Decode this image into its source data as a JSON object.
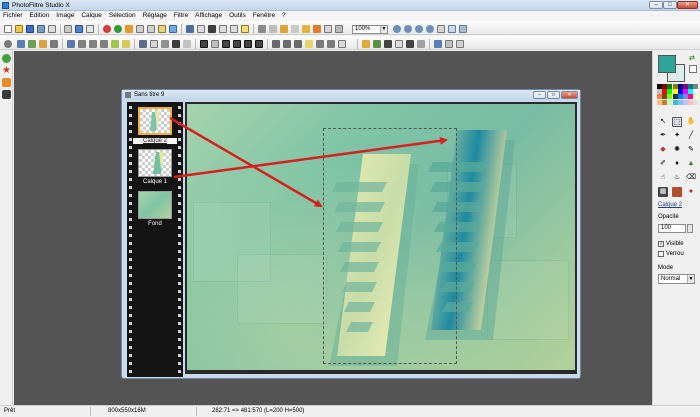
{
  "window": {
    "title": "PhotoFiltre Studio X",
    "min": "–",
    "max": "□",
    "close": "✕"
  },
  "menu": [
    "Fichier",
    "Edition",
    "Image",
    "Calque",
    "Sélection",
    "Réglage",
    "Filtre",
    "Affichage",
    "Outils",
    "Fenêtre",
    "?"
  ],
  "toolbar": {
    "zoom_value": "100%",
    "zoom_arrow": "▼"
  },
  "document": {
    "title": "Sans titre 9",
    "layers": [
      {
        "label": "Calque 2",
        "selected": true
      },
      {
        "label": "Calque 1",
        "selected": false
      },
      {
        "label": "Fond",
        "selected": false
      }
    ]
  },
  "right_panel": {
    "foreground_color": "#2ea597",
    "background_color": "#dbeeed",
    "swap_glyph": "⇄",
    "layer_name": "Calque 2",
    "opacity_label": "Opacité",
    "opacity_value": "100",
    "visible_label": "Visible",
    "visible_checked": "✓",
    "lock_label": "Verrou",
    "mode_label": "Mode",
    "mode_value": "Normal",
    "mode_arrow": "▼"
  },
  "status": {
    "state": "Prêt",
    "image_size": "800x550x16M",
    "coords": "282:71 => 481:570 (L=200  H=500)"
  },
  "colors": {
    "arrow": "#d81f1f",
    "selected_layer_border": "#f0b13a"
  }
}
